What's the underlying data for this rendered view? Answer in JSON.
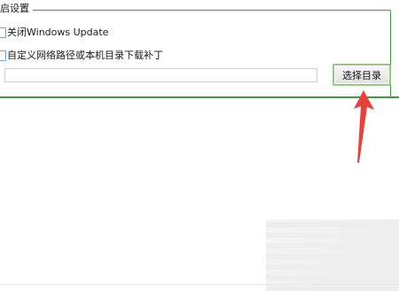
{
  "group": {
    "title": "启设置"
  },
  "options": {
    "disable_update_label": "关闭Windows Update",
    "custom_path_label": "自定义网络路径或本机目录下载补丁"
  },
  "path_input": {
    "value": "",
    "placeholder": ""
  },
  "choose_button": {
    "label": "选择目录"
  },
  "colors": {
    "group_border": "#3f9a46",
    "button_border": "#96c97d",
    "arrow": "#e8413a"
  },
  "icons": {
    "annotation": "red-arrow-icon"
  }
}
